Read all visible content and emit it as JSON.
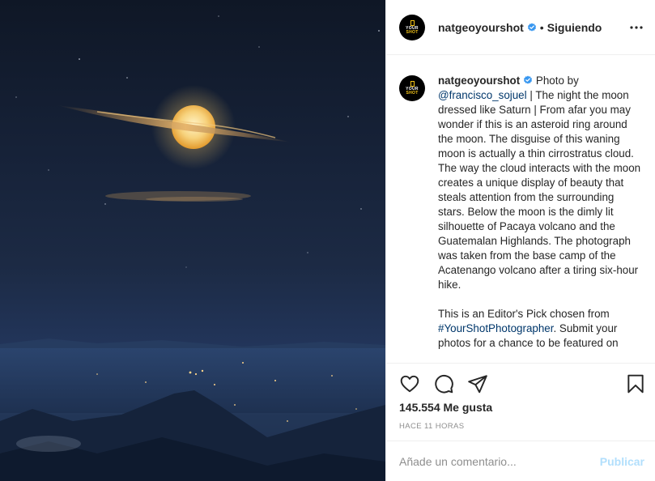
{
  "photo": {
    "description_icon": "moon-with-cloud-ring-photo"
  },
  "header": {
    "avatar_text_line1": "YOUR",
    "avatar_text_line2": "SHOT",
    "username": "natgeoyourshot",
    "separator": "•",
    "follow_status": "Siguiendo",
    "more_icon": "more-horizontal-icon",
    "verified_icon": "verified-badge-icon"
  },
  "caption": {
    "username": "natgeoyourshot",
    "prefix": "Photo by",
    "mention": "@francisco_sojuel",
    "body": "| The night the moon dressed like Saturn | From afar you may wonder if this is an asteroid ring around the moon. The disguise of this waning moon is actually a thin cirrostratus cloud. The way the cloud interacts with the moon creates a unique display of beauty that steals attention from the surrounding stars. Below the moon is the dimly lit silhouette of Pacaya volcano and the Guatemalan Highlands. The photograph was taken from the base camp of the Acatenango volcano after a tiring six-hour hike.",
    "para2_prefix": "This is an Editor's Pick chosen from",
    "hashtag": "#YourShotPhotographer",
    "para2_suffix": ". Submit your photos for a chance to be featured on"
  },
  "actions": {
    "like_icon": "heart-icon",
    "comment_icon": "comment-icon",
    "share_icon": "share-paper-plane-icon",
    "save_icon": "bookmark-icon",
    "likes": "145.554 Me gusta",
    "timestamp": "HACE 11 HORAS"
  },
  "comment": {
    "placeholder": "Añade un comentario...",
    "publish_label": "Publicar"
  },
  "colors": {
    "accent_link": "#00376b",
    "verified_blue": "#3897f0",
    "publish_disabled": "#b2dffc",
    "natgeo_yellow": "#f5c518"
  }
}
